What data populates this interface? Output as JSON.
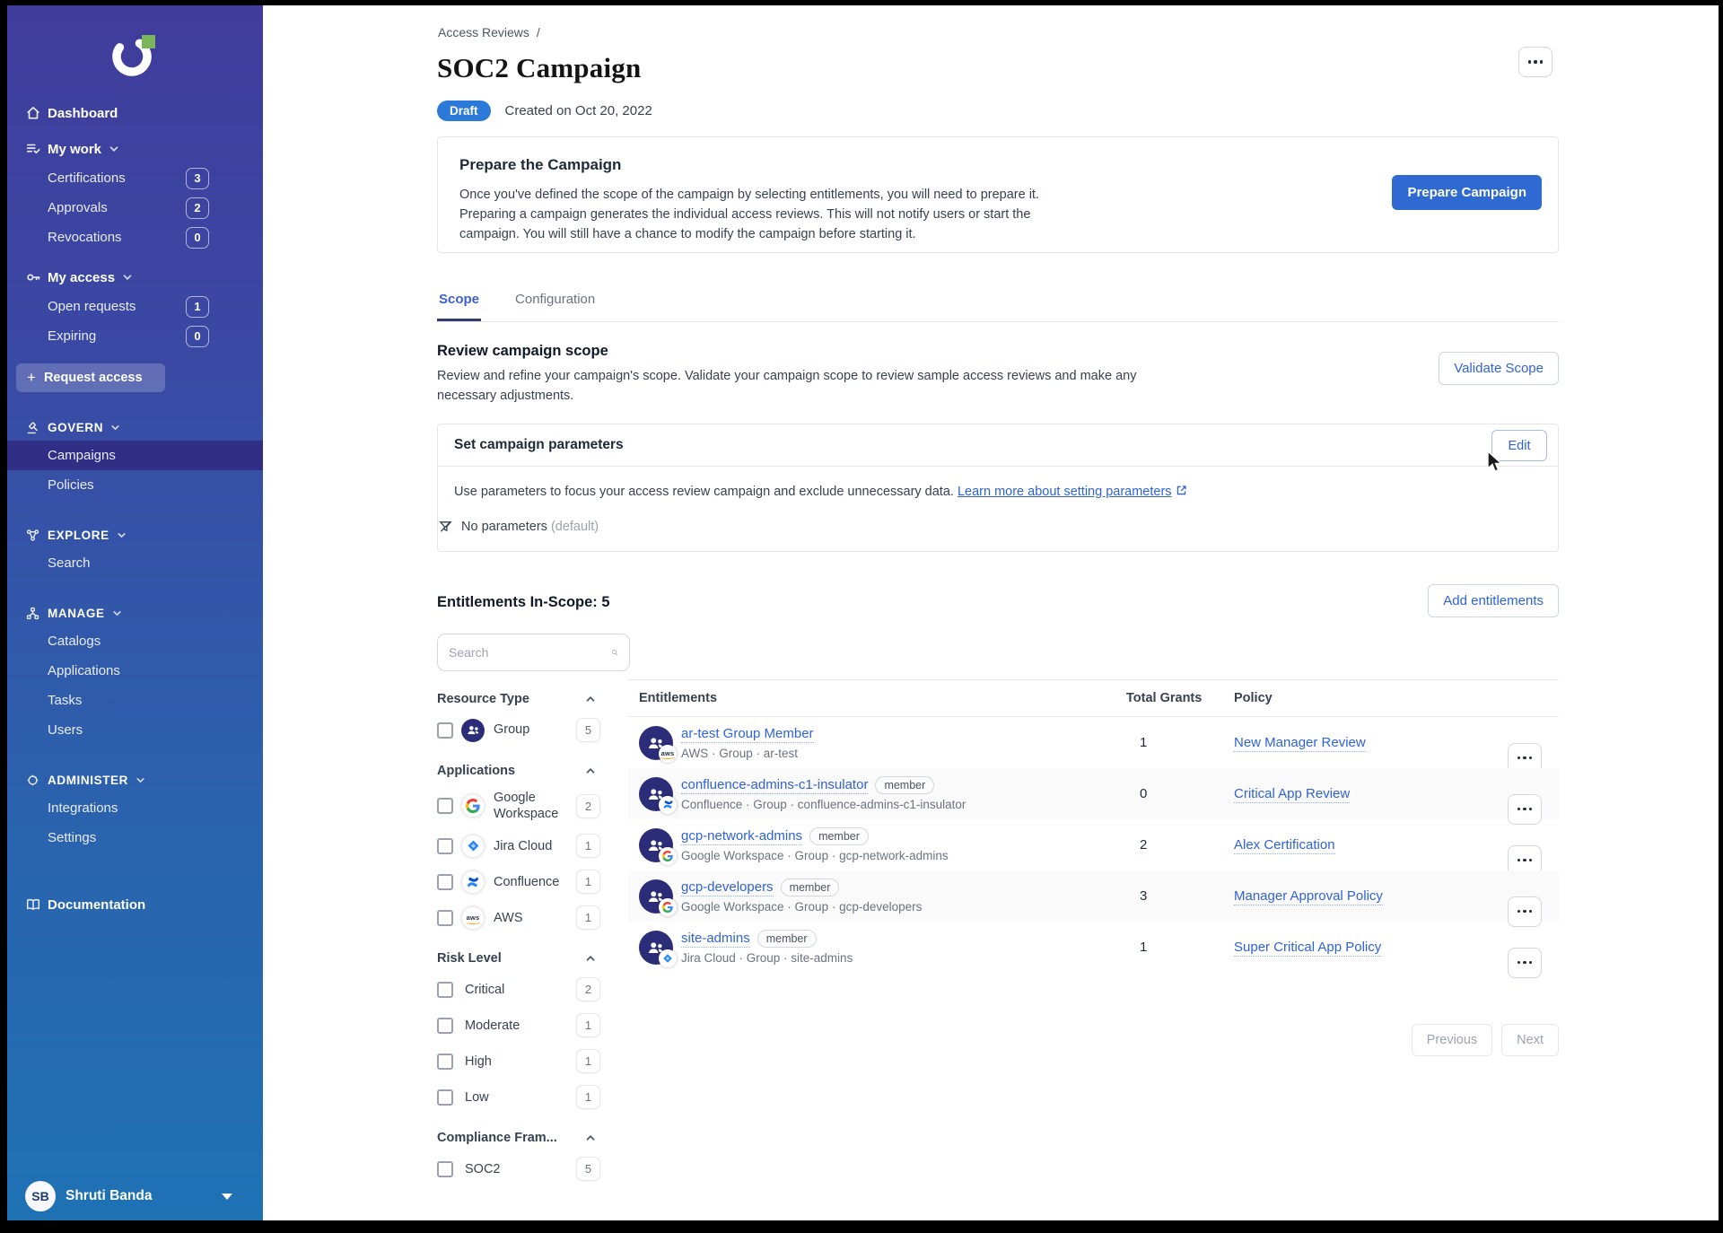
{
  "sidebar": {
    "dashboard_label": "Dashboard",
    "my_work": {
      "label": "My work",
      "items": [
        {
          "label": "Certifications",
          "count": "3"
        },
        {
          "label": "Approvals",
          "count": "2"
        },
        {
          "label": "Revocations",
          "count": "0"
        }
      ]
    },
    "my_access": {
      "label": "My access",
      "items": [
        {
          "label": "Open requests",
          "count": "1"
        },
        {
          "label": "Expiring",
          "count": "0"
        }
      ]
    },
    "request_access_label": "Request access",
    "govern": {
      "label": "GOVERN",
      "items": [
        {
          "label": "Campaigns"
        },
        {
          "label": "Policies"
        }
      ]
    },
    "explore": {
      "label": "EXPLORE",
      "items": [
        {
          "label": "Search"
        }
      ]
    },
    "manage": {
      "label": "MANAGE",
      "items": [
        {
          "label": "Catalogs"
        },
        {
          "label": "Applications"
        },
        {
          "label": "Tasks"
        },
        {
          "label": "Users"
        }
      ]
    },
    "administer": {
      "label": "ADMINISTER",
      "items": [
        {
          "label": "Integrations"
        },
        {
          "label": "Settings"
        }
      ]
    },
    "documentation_label": "Documentation",
    "selected_item": "Campaigns",
    "user": {
      "initials": "SB",
      "name": "Shruti Banda"
    }
  },
  "breadcrumb": {
    "section": "Access Reviews",
    "separator": "/"
  },
  "header": {
    "title": "SOC2 Campaign",
    "status_badge": "Draft",
    "created": "Created on Oct 20, 2022"
  },
  "prepare_card": {
    "title": "Prepare the Campaign",
    "body": "Once you've defined the scope of the campaign by selecting entitlements, you will need to prepare it. Preparing a campaign generates the individual access reviews. This will not notify users or start the campaign. You will still have a chance to modify the campaign before starting it.",
    "button": "Prepare Campaign"
  },
  "tabs": {
    "scope": "Scope",
    "configuration": "Configuration",
    "active": "Scope"
  },
  "scope_section": {
    "title": "Review campaign scope",
    "description": "Review and refine your campaign's scope. Validate your campaign scope to review sample access reviews and make any necessary adjustments.",
    "validate_button": "Validate Scope"
  },
  "parameters_card": {
    "title": "Set campaign parameters",
    "edit_button": "Edit",
    "body": "Use parameters to focus your access review campaign and exclude unnecessary data.",
    "link_text": "Learn more about setting parameters",
    "empty_state": "No parameters",
    "empty_state_note": "(default)"
  },
  "entitlements_section": {
    "title": "Entitlements In-Scope: 5",
    "add_button": "Add entitlements",
    "search_placeholder": "Search"
  },
  "filters": {
    "resource_type": {
      "label": "Resource Type",
      "items": [
        {
          "label": "Group",
          "count": "5",
          "icon": "group-icon"
        }
      ]
    },
    "applications": {
      "label": "Applications",
      "items": [
        {
          "label": "Google Workspace",
          "count": "2",
          "icon": "google-workspace-icon"
        },
        {
          "label": "Jira Cloud",
          "count": "1",
          "icon": "jira-cloud-icon"
        },
        {
          "label": "Confluence",
          "count": "1",
          "icon": "confluence-icon"
        },
        {
          "label": "AWS",
          "count": "1",
          "icon": "aws-icon"
        }
      ]
    },
    "risk_level": {
      "label": "Risk Level",
      "items": [
        {
          "label": "Critical",
          "count": "2"
        },
        {
          "label": "Moderate",
          "count": "1"
        },
        {
          "label": "High",
          "count": "1"
        },
        {
          "label": "Low",
          "count": "1"
        }
      ]
    },
    "compliance": {
      "label": "Compliance Fram...",
      "items": [
        {
          "label": "SOC2",
          "count": "5"
        }
      ]
    }
  },
  "table": {
    "columns": {
      "entitlements": "Entitlements",
      "total_grants": "Total Grants",
      "policy": "Policy"
    },
    "rows": [
      {
        "name": "ar-test Group Member",
        "member_badge": "",
        "app_icon": "aws-icon",
        "subtitle": "AWS · Group · ar-test",
        "grants": "1",
        "policy": "New Manager Review"
      },
      {
        "name": "confluence-admins-c1-insulator",
        "member_badge": "member",
        "app_icon": "confluence-icon",
        "subtitle": "Confluence · Group · confluence-admins-c1-insulator",
        "grants": "0",
        "policy": "Critical App Review"
      },
      {
        "name": "gcp-network-admins",
        "member_badge": "member",
        "app_icon": "google-workspace-icon",
        "subtitle": "Google Workspace · Group · gcp-network-admins",
        "grants": "2",
        "policy": "Alex Certification"
      },
      {
        "name": "gcp-developers",
        "member_badge": "member",
        "app_icon": "google-workspace-icon",
        "subtitle": "Google Workspace · Group · gcp-developers",
        "grants": "3",
        "policy": "Manager Approval Policy"
      },
      {
        "name": "site-admins",
        "member_badge": "member",
        "app_icon": "jira-cloud-icon",
        "subtitle": "Jira Cloud · Group · site-admins",
        "grants": "1",
        "policy": "Super Critical App Policy"
      }
    ],
    "pagination": {
      "previous": "Previous",
      "next": "Next"
    }
  },
  "colors": {
    "sidebar_top": "#403C9C",
    "sidebar_bottom": "#1E72B4",
    "selected_nav": "#312E86",
    "primary_blue": "#2E6AD1",
    "link_blue": "#2F62D8",
    "draft_badge": "#2B7AD9",
    "logo_accent_green": "#7CB65C"
  }
}
